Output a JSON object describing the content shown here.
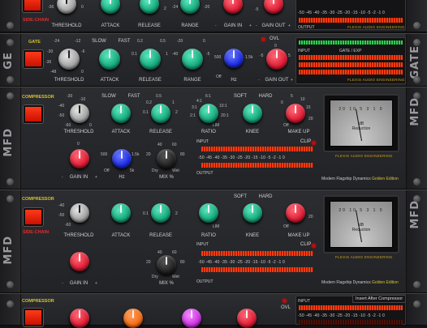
{
  "colors": {
    "accent_gold": "#d8c230",
    "accent_red": "#d93030",
    "knob_green": "#13a577",
    "knob_red": "#dd1a32",
    "knob_blue": "#1a2ae0",
    "meter_red": "#ff3b10"
  },
  "scale_text": "-50 -45 -40 -35 -30 -25 -20 -15 -10 -5 -2 -1 0",
  "brand_text": "FLEXIS AUDIO ENGINEERING",
  "edition": {
    "prefix": "Modern Flagship Dynamics",
    "suffix": "Golden Edition"
  },
  "ear_labels": {
    "ge": "GE",
    "gate": "GATE",
    "mfd": "MFD"
  },
  "ge": {
    "sidechain": "SIDE-CHAIN",
    "knobs": {
      "threshold": "THRESHOLD",
      "attack": "ATTACK",
      "release": "RELEASE",
      "range": "RANGE",
      "gain_in": "GAIN IN",
      "gain_out": "GAIN OUT"
    },
    "scales": {
      "t1": "-36",
      "t2": "0",
      "r1": "2",
      "g1": "-24",
      "g2": "-20",
      "go1": "-5"
    },
    "signs": {
      "minus1": "-",
      "plus1": "+",
      "minus2": "-",
      "plus2": "+"
    },
    "output": "OUTPUT"
  },
  "gate": {
    "tag": "GATE",
    "ovl": "OVL",
    "knobs": {
      "threshold": "THRESHOLD",
      "attack": "ATTACK",
      "release": "RELEASE",
      "range": "RANGE",
      "hz": "Hz",
      "gain_out": "GAIN OUT"
    },
    "speed": {
      "slow": "SLOW",
      "fast": "FAST"
    },
    "scales": {
      "t1": "-24",
      "t2": "-12",
      "t3": "-6",
      "t4": "-30",
      "t5": "-36",
      "t6": "-48",
      "t7": "0",
      "r1": "0.2",
      "r2": "0.5",
      "r3": "0.1",
      "r4": "1",
      "g1": "-20",
      "g2": "0",
      "g3": "-40",
      "g4": "-5",
      "h1": "500",
      "h2": "1.5k",
      "h3": "Off",
      "h4": "5k",
      "o1": "0",
      "o2": "5",
      "o3": "-5"
    },
    "input": "INPUT",
    "gate_exp": "GATE / EXP",
    "signs": {
      "minus": "-",
      "plus": "+"
    }
  },
  "mfd1": {
    "tag": "COMPRESSOR",
    "knobs": {
      "threshold": "THRESHOLD",
      "attack": "ATTACK",
      "release": "RELEASE",
      "ratio": "RATIO",
      "knee": "KNEE",
      "makeup": "MAKE UP",
      "gain_in": "GAIN IN",
      "hz": "Hz",
      "mix": "MIX %"
    },
    "speed": {
      "slow": "SLOW",
      "fast": "FAST"
    },
    "knee": {
      "soft": "SOFT",
      "hard": "HARD"
    },
    "scales": {
      "t1": "-30",
      "t2": "-20",
      "t3": "-10",
      "t4": "-40",
      "t5": "-50",
      "t6": "-60",
      "t7": "0",
      "r1": "0.5",
      "r2": "0.2",
      "r3": "1",
      "r4": "0.1",
      "r5": "2",
      "ra1": "6:1",
      "ra2": "4:1",
      "ra3": "3:1",
      "ra4": "2:1",
      "ra5": "10:1",
      "ra6": "20:1",
      "ra7": "LIM",
      "m1": "5",
      "m2": "10",
      "m3": "0",
      "m4": "15",
      "m5": "Off",
      "m6": "20",
      "g1": "0",
      "h1": "500",
      "h2": "1.5k",
      "h3": "Off",
      "h4": "5k",
      "x1": "40",
      "x2": "60",
      "x3": "20",
      "x4": "80",
      "x5": "Dry",
      "x6": "Wet"
    },
    "input": "INPUT",
    "output": "OUTPUT",
    "clip": "CLIP",
    "vu": {
      "db": "dB",
      "reduction": "Reduction",
      "scale": "20 10 5 3 1 0"
    },
    "signs": {
      "minus": "-",
      "plus": "+"
    }
  },
  "mfd2": {
    "tag": "COMPRESSOR",
    "sidechain": "SIDE-CHAIN",
    "knobs": {
      "threshold": "THRESHOLD",
      "attack": "ATTACK",
      "release": "RELEASE",
      "ratio": "RATIO",
      "knee": "KNEE",
      "makeup": "MAKE UP",
      "gain_in": "GAIN IN",
      "mix": "MIX %"
    },
    "knee": {
      "soft": "SOFT",
      "hard": "HARD"
    },
    "scales": {
      "t1": "-40",
      "t2": "-50",
      "t3": "-60",
      "r1": "0.1",
      "r2": "2",
      "ra1": "LIM",
      "m1": "Off",
      "m2": "20",
      "x1": "40",
      "x2": "60",
      "x3": "20",
      "x4": "80",
      "x5": "Dry",
      "x6": "Wet"
    },
    "input": "INPUT",
    "output": "OUTPUT",
    "clip": "CLIP",
    "vu": {
      "db": "dB",
      "reduction": "Reduction",
      "scale": "20 10 5 3 1 0"
    },
    "signs": {
      "minus": "-",
      "plus": "+"
    }
  },
  "bottom": {
    "tag": "COMPRESSOR",
    "ovl": "OVL",
    "input": "INPUT",
    "insert": "Insert After Compressor",
    "scale_text": "-50 -45 -40 -35 -30 -25 -20 -15 -10 -5 -2 -1 0"
  }
}
